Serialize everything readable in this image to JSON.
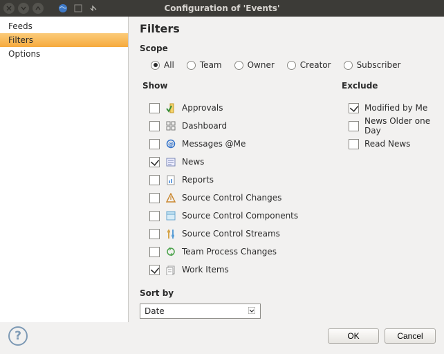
{
  "window": {
    "title": "Configuration of 'Events'"
  },
  "sidebar": {
    "items": [
      {
        "label": "Feeds",
        "selected": false
      },
      {
        "label": "Filters",
        "selected": true
      },
      {
        "label": "Options",
        "selected": false
      }
    ]
  },
  "page": {
    "title": "Filters",
    "scope_label": "Scope",
    "scope_options": [
      {
        "label": "All",
        "checked": true
      },
      {
        "label": "Team",
        "checked": false
      },
      {
        "label": "Owner",
        "checked": false
      },
      {
        "label": "Creator",
        "checked": false
      },
      {
        "label": "Subscriber",
        "checked": false
      }
    ],
    "show_label": "Show",
    "show_items": [
      {
        "label": "Approvals",
        "checked": false,
        "icon": "approvals"
      },
      {
        "label": "Dashboard",
        "checked": false,
        "icon": "dashboard"
      },
      {
        "label": "Messages @Me",
        "checked": false,
        "icon": "messages"
      },
      {
        "label": "News",
        "checked": true,
        "icon": "news"
      },
      {
        "label": "Reports",
        "checked": false,
        "icon": "reports"
      },
      {
        "label": "Source Control Changes",
        "checked": false,
        "icon": "sc-changes"
      },
      {
        "label": "Source Control Components",
        "checked": false,
        "icon": "sc-comp"
      },
      {
        "label": "Source Control Streams",
        "checked": false,
        "icon": "sc-stream"
      },
      {
        "label": "Team Process Changes",
        "checked": false,
        "icon": "team-proc"
      },
      {
        "label": "Work Items",
        "checked": true,
        "icon": "work-items"
      }
    ],
    "exclude_label": "Exclude",
    "exclude_items": [
      {
        "label": "Modified by Me",
        "checked": true
      },
      {
        "label": "News Older one Day",
        "checked": false
      },
      {
        "label": "Read News",
        "checked": false
      }
    ],
    "sort_label": "Sort by",
    "sort_value": "Date"
  },
  "footer": {
    "ok": "OK",
    "cancel": "Cancel"
  }
}
